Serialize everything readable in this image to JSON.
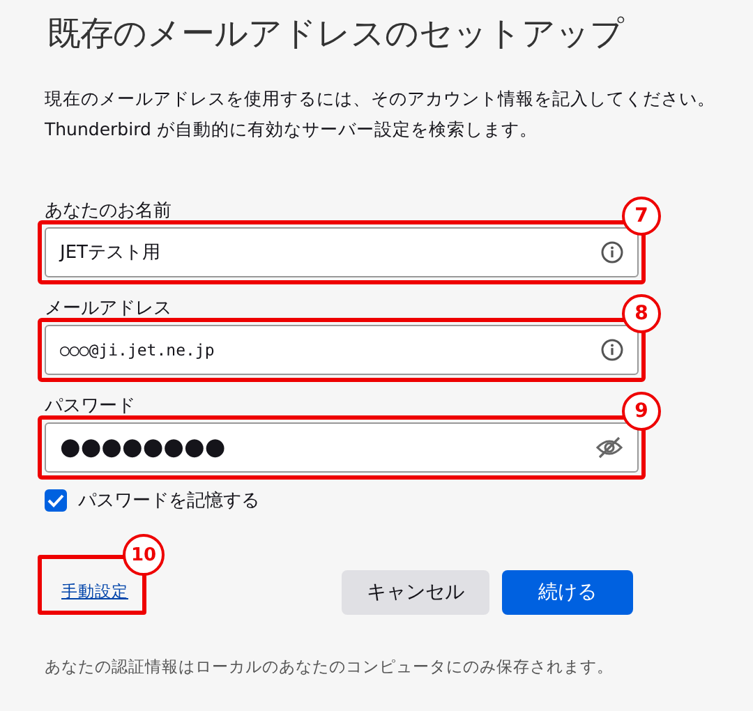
{
  "title": "既存のメールアドレスのセットアップ",
  "description": [
    "現在のメールアドレスを使用するには、そのアカウント情報を記入してください。",
    "Thunderbird が自動的に有効なサーバー設定を検索します。"
  ],
  "fields": [
    {
      "kind": "text",
      "label": "あなたのお名前",
      "value": "JETテスト用",
      "callout": "7"
    },
    {
      "kind": "email",
      "label": "メールアドレス",
      "value": "○○○@ji.jet.ne.jp",
      "callout": "8"
    },
    {
      "kind": "password",
      "label": "パスワード",
      "value": "●●●●●●●●",
      "callout": "9"
    }
  ],
  "remember_password": {
    "label": "パスワードを記憶する",
    "checked": true
  },
  "manual_link": {
    "label": "手動設定",
    "callout": "10"
  },
  "buttons": [
    {
      "label": "キャンセル",
      "kind": "secondary"
    },
    {
      "label": "続ける",
      "kind": "primary"
    }
  ],
  "footer": "あなたの認証情報はローカルのあなたのコンピュータにのみ保存されます。"
}
